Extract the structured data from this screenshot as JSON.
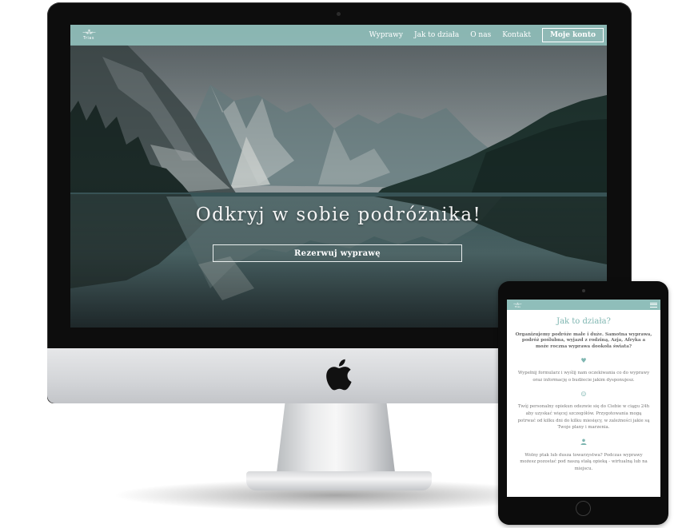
{
  "desktop": {
    "logo": {
      "mark": "→⁂←",
      "text": "Trias"
    },
    "nav": {
      "links": [
        "Wyprawy",
        "Jak to działa",
        "O nas",
        "Kontakt"
      ],
      "account_button": "Moje konto"
    },
    "hero": {
      "title": "Odkryj w sobie podróżnika!",
      "button": "Rezerwuj wyprawę"
    }
  },
  "tablet": {
    "logo": {
      "mark": "→⁂←",
      "text": "Trias"
    },
    "menu_icon": "hamburger-icon",
    "heading": "Jak to działa?",
    "intro": [
      "Organizujemy podróże małe i duże. Samotna wyprawa,",
      "podróż poślubna, wyjazd z rodziną, Azja, Afryka a",
      "może roczna wyprawa dookoła świata?"
    ],
    "steps": [
      {
        "icon": "heart-icon",
        "glyph": "♥",
        "lines": [
          "Wypełnij formularz i wyślij nam oczekiwania co do wyprawy",
          "oraz informację o budżecie jakim dysponujesz."
        ]
      },
      {
        "icon": "smiley-icon",
        "glyph": "☺",
        "lines": [
          "Twój personalny opiekun odezwie się do Ciebie w ciągu 24h",
          "aby uzyskać więcej szczegółów. Przygotowania mogą",
          "potrwać od kilku dni do kilku miesięcy, w zależności jakie są",
          "Twoje plany i marzenia."
        ]
      },
      {
        "icon": "user-icon",
        "glyph": "👤",
        "lines": [
          "Wolny ptak lub dusza towarzystwa? Podczas wyprawy",
          "możesz pozostać pod naszą stałą opieką - wirtualną lub na",
          "miejscu."
        ]
      }
    ]
  },
  "colors": {
    "accent": "#8fbeba",
    "accent_text": "#7fb6b1",
    "device_black": "#0d0d0d"
  }
}
